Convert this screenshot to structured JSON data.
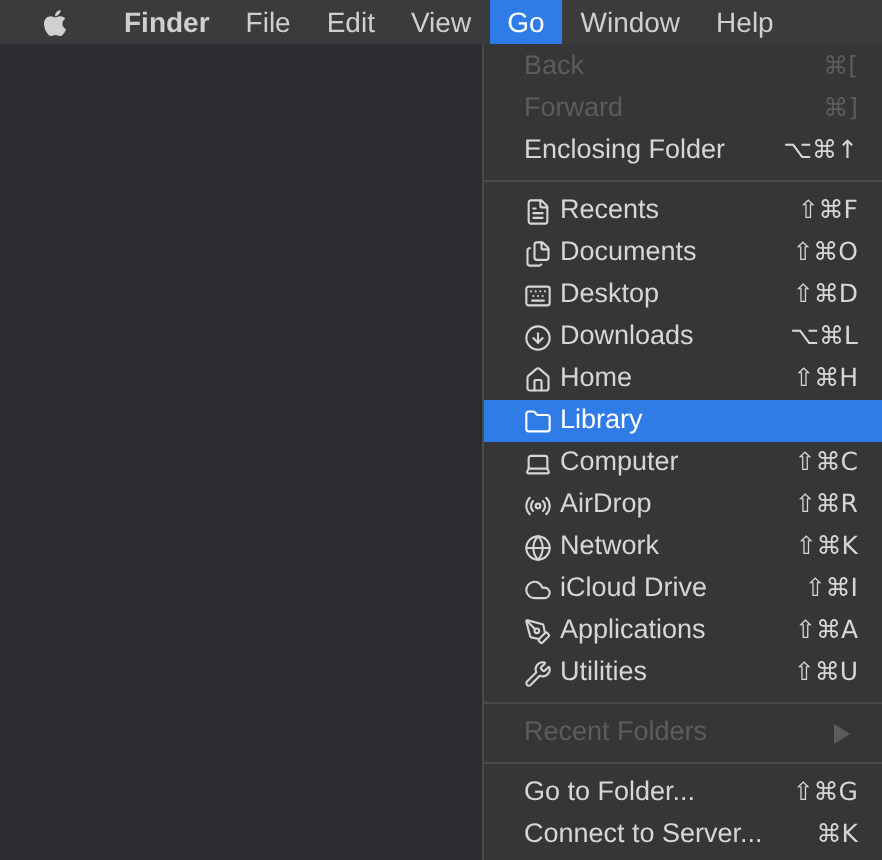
{
  "menu_bar": {
    "items": [
      {
        "label": "Finder",
        "bold": true,
        "selected": false
      },
      {
        "label": "File",
        "bold": false,
        "selected": false
      },
      {
        "label": "Edit",
        "bold": false,
        "selected": false
      },
      {
        "label": "View",
        "bold": false,
        "selected": false
      },
      {
        "label": "Go",
        "bold": false,
        "selected": true
      },
      {
        "label": "Window",
        "bold": false,
        "selected": false
      },
      {
        "label": "Help",
        "bold": false,
        "selected": false
      }
    ]
  },
  "go_menu": {
    "sections": [
      [
        {
          "label": "Back",
          "shortcut": "⌘[",
          "disabled": true,
          "selected": false,
          "kind": "plain"
        },
        {
          "label": "Forward",
          "shortcut": "⌘]",
          "disabled": true,
          "selected": false,
          "kind": "plain"
        },
        {
          "label": "Enclosing Folder",
          "shortcut": "⌥⌘↑",
          "disabled": false,
          "selected": false,
          "kind": "plain"
        }
      ],
      [
        {
          "label": "Recents",
          "shortcut": "⇧⌘F",
          "disabled": false,
          "selected": false,
          "kind": "place"
        },
        {
          "label": "Documents",
          "shortcut": "⇧⌘O",
          "disabled": false,
          "selected": false,
          "kind": "place"
        },
        {
          "label": "Desktop",
          "shortcut": "⇧⌘D",
          "disabled": false,
          "selected": false,
          "kind": "place"
        },
        {
          "label": "Downloads",
          "shortcut": "⌥⌘L",
          "disabled": false,
          "selected": false,
          "kind": "place"
        },
        {
          "label": "Home",
          "shortcut": "⇧⌘H",
          "disabled": false,
          "selected": false,
          "kind": "place"
        },
        {
          "label": "Library",
          "disabled": false,
          "selected": true,
          "kind": "place"
        },
        {
          "label": "Computer",
          "shortcut": "⇧⌘C",
          "disabled": false,
          "selected": false,
          "kind": "place"
        },
        {
          "label": "AirDrop",
          "shortcut": "⇧⌘R",
          "disabled": false,
          "selected": false,
          "kind": "place"
        },
        {
          "label": "Network",
          "shortcut": "⇧⌘K",
          "disabled": false,
          "selected": false,
          "kind": "place"
        },
        {
          "label": "iCloud Drive",
          "shortcut": "⇧⌘I",
          "disabled": false,
          "selected": false,
          "kind": "place"
        },
        {
          "label": "Applications",
          "shortcut": "⇧⌘A",
          "disabled": false,
          "selected": false,
          "kind": "place"
        },
        {
          "label": "Utilities",
          "shortcut": "⇧⌘U",
          "disabled": false,
          "selected": false,
          "kind": "place"
        }
      ],
      [
        {
          "label": "Recent Folders",
          "disabled": true,
          "selected": false,
          "kind": "submenu"
        }
      ],
      [
        {
          "label": "Go to Folder...",
          "shortcut": "⇧⌘G",
          "disabled": false,
          "selected": false,
          "kind": "plain"
        },
        {
          "label": "Connect to Server...",
          "shortcut": "⌘K",
          "disabled": false,
          "selected": false,
          "kind": "plain"
        }
      ]
    ]
  }
}
